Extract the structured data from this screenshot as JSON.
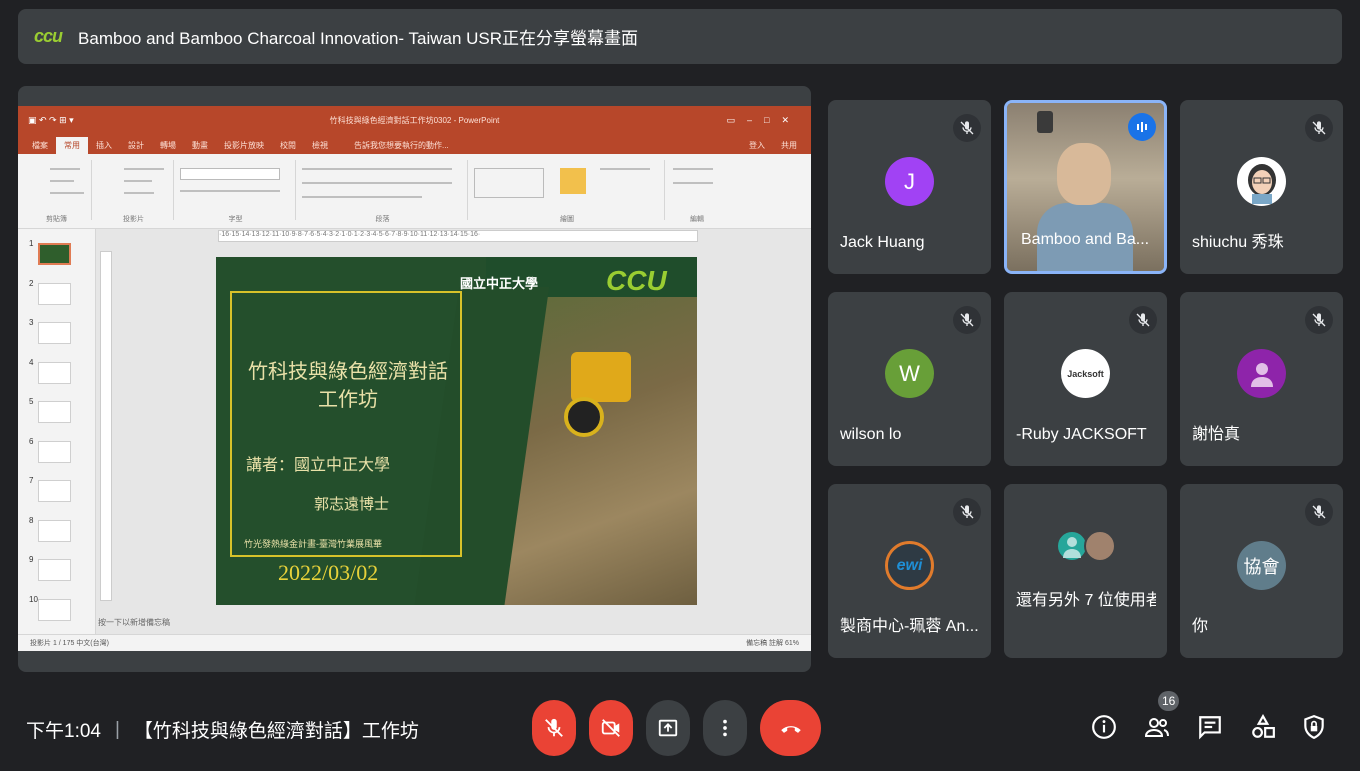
{
  "banner": {
    "logo": "ccu",
    "text": "Bamboo and Bamboo Charcoal Innovation- Taiwan USR正在分享螢幕畫面"
  },
  "powerpoint": {
    "title_bar": "竹科技與綠色經濟對話工作坊0302 - PowerPoint",
    "tabs": [
      "檔案",
      "常用",
      "插入",
      "設計",
      "轉場",
      "動畫",
      "投影片放映",
      "校閱",
      "檢視"
    ],
    "active_tab": "常用",
    "search_hint": "告訴我您想要執行的動作...",
    "sign_in": "登入",
    "share": "共用",
    "ribbon_groups": [
      "剪貼簿",
      "投影片",
      "字型",
      "段落",
      "繪圖",
      "編輯"
    ],
    "ruler_text": "·16·15·14·13·12·11·10·9·8·7·6·5·4·3·2·1·0·1·2·3·4·5·6·7·8·9·10·11·12·13·14·15·16·",
    "thumbnail_numbers": [
      "1",
      "2",
      "3",
      "4",
      "5",
      "6",
      "7",
      "8",
      "9",
      "10"
    ],
    "slide": {
      "title_line1": "竹科技與綠色經濟對話",
      "title_line2": "工作坊",
      "speaker": "講者：國立中正大學",
      "speaker2": "郭志遠博士",
      "footer": "竹光發熱綠金計畫-臺灣竹業展風華",
      "date": "2022/03/02",
      "university": "國立中正大學",
      "ccu_logo": "CCU"
    },
    "notes_placeholder": "按一下以新增備忘稿",
    "status_left": "投影片 1 / 175    中文(台灣)",
    "status_right": "備忘稿    註解    61%"
  },
  "participants": [
    {
      "name": "Jack Huang",
      "initial": "J",
      "avatar_color": "#a142f4",
      "muted": true
    },
    {
      "name": "Bamboo and Ba...",
      "video": true,
      "speaking": true,
      "muted": false
    },
    {
      "name": "shiuchu 秀珠",
      "avatar_type": "cartoon",
      "muted": true
    },
    {
      "name": "wilson lo",
      "initial": "W",
      "avatar_color": "#689f38",
      "muted": true
    },
    {
      "name": "-Ruby JACKSOFT",
      "avatar_type": "logo",
      "avatar_text": "Jacksoft",
      "muted": true
    },
    {
      "name": "謝怡真",
      "avatar_type": "person",
      "avatar_color": "#8e24aa",
      "muted": true
    },
    {
      "name": "製商中心-珮蓉 An...",
      "avatar_type": "logo",
      "avatar_text": "ewi",
      "muted": true
    },
    {
      "name": "還有另外 7 位使用者",
      "avatar_type": "group",
      "muted": false
    },
    {
      "name": "你",
      "initial": "協會",
      "avatar_color": "#607d8b",
      "muted": true
    }
  ],
  "bottom_bar": {
    "time": "下午1:04",
    "separator": "|",
    "meeting_title": "【竹科技與綠色經濟對話】工作坊",
    "participant_count": "16"
  },
  "colors": {
    "background": "#202124",
    "tile": "#3c4043",
    "danger": "#ea4335",
    "accent": "#8ab4f8"
  }
}
